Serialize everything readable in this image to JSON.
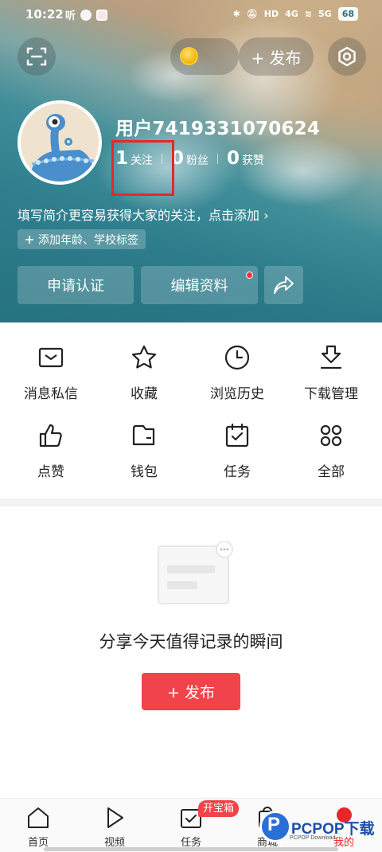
{
  "status_bar": {
    "time": "10:22",
    "app_text": "听",
    "network_1": "4G",
    "network_2": "5G",
    "battery": "68"
  },
  "header": {
    "publish_label": "+ 发布"
  },
  "profile": {
    "username": "用户7419331070624",
    "stats": [
      {
        "value": "1",
        "label": "关注"
      },
      {
        "value": "0",
        "label": "粉丝"
      },
      {
        "value": "0",
        "label": "获赞"
      }
    ],
    "bio": "填写简介更容易获得大家的关注，点击添加 ›",
    "tag_chip": "添加年龄、学校标签",
    "buttons": {
      "verify": "申请认证",
      "edit": "编辑资料"
    }
  },
  "features": [
    {
      "label": "消息私信",
      "icon": "message-icon"
    },
    {
      "label": "收藏",
      "icon": "star-icon"
    },
    {
      "label": "浏览历史",
      "icon": "clock-icon"
    },
    {
      "label": "下载管理",
      "icon": "download-icon"
    },
    {
      "label": "点赞",
      "icon": "thumbs-up-icon"
    },
    {
      "label": "钱包",
      "icon": "wallet-icon"
    },
    {
      "label": "任务",
      "icon": "calendar-check-icon"
    },
    {
      "label": "全部",
      "icon": "grid-icon"
    }
  ],
  "empty_state": {
    "text": "分享今天值得记录的瞬间",
    "publish_button": "+ 发布"
  },
  "bottom_nav": {
    "items": [
      {
        "label": "首页",
        "icon": "home-icon"
      },
      {
        "label": "视频",
        "icon": "play-icon"
      },
      {
        "label": "任务",
        "icon": "task-icon"
      },
      {
        "label": "商城",
        "icon": "mall-icon"
      },
      {
        "label": "我的",
        "icon": "user-icon"
      }
    ],
    "badge": "开宝箱",
    "active": "我的"
  },
  "watermark": {
    "brand": "PCPOP下载",
    "sub": "PCPOP Download"
  },
  "colors": {
    "accent": "#f0444a",
    "highlight_box": "#e8262a"
  }
}
